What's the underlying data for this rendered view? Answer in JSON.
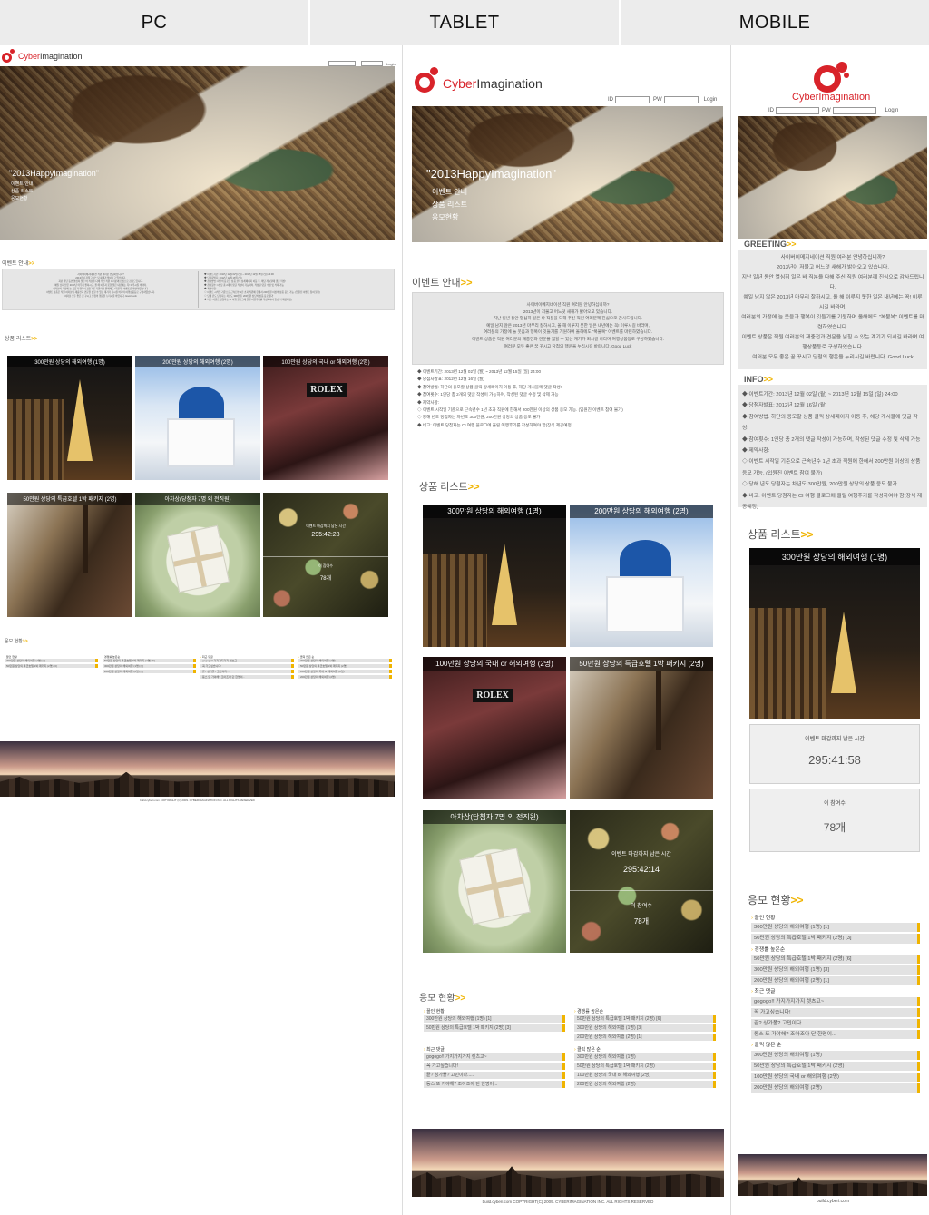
{
  "columns": {
    "pc": "PC",
    "tablet": "TABLET",
    "mobile": "MOBILE"
  },
  "logo": {
    "prefix": "Cyber",
    "suffix": "Imagination"
  },
  "login": {
    "id_label": "ID",
    "pw_label": "PW",
    "button": "Login"
  },
  "hero": {
    "title": "\"2013HappyImagination\"",
    "menu": [
      "이벤트 안내",
      "상품 리스트",
      "응모현황"
    ]
  },
  "sections": {
    "event": "이벤트 안내",
    "greeting": "GREETING",
    "info": "INFO",
    "products": "상품 리스트",
    "status": "응모 현황"
  },
  "greeting_text": [
    "사이버이메지네이션 직원 여러분 안녕하십니까?",
    "2013년이 저물고 어느덧 새해가 밝아오고 있습니다.",
    "지난 일년 동안 열심히 일은 바 직분을 다해 주신 직원 여러분께 진심으로 감사드립니다.",
    "예일 남지 않은 2013년 마무리 잘하시고, 올 해 이루지 못한 일은 내년에는 꼭! 이루시길 바라며,",
    "여러분의 가정에 늘 웃음과 행복이 깃들기를 기원하며 올해에도 \"복불복\" 이벤트를 마련하였습니다.",
    "이벤트 상품은 직원 여러분의 재충전과 견문을 넓힐 수 있는 계기가 되시길 바라며 여행상품등로 구성하였습니다.",
    "여러분 모두 좋은 꿈 꾸시고 당첨의 행운을 누리시길 바랍니다. Good Luck"
  ],
  "info_items": [
    "◆ 이벤트기간: 2013년 12월 02일 (월) ~ 2013년 12월 15일 (일) 24:00",
    "◆ 당첨자발표: 2012년 12월 16일 (월)",
    "◆ 참여방법: 하단의 응모할 상품 클릭 상세페이지 이동 후, 해당 게시물에 댓글 작성!",
    "◆ 참여횟수: 1인당 총 2개의 댓글 작성이 가능하며, 작성된 댓글 수정 및 삭제 가능",
    "◆ 제약사항:",
    "◇ 이벤트 시작일 기준으로 근속년수 1년 초과 직원에 한해서 200만원 이상의 상품 응모 가능. (입원진 이벤트 참여 불가)",
    "◇ 당해 년도 당첨자는 차년도 300만원, 200만원 상당의 상품 응모 불가",
    "◆ 비고: 이벤트 당첨자는 CI 여행 블로그에 올릴 여행후기를 작성하여야 함(장식 제공예정)"
  ],
  "products": [
    {
      "label": "300만원 상당의 해외여행 (1명)"
    },
    {
      "label": "200만원 상당의 해외여행 (2명)"
    },
    {
      "label": "100만원 상당의 국내 or 해외여행 (2명)"
    },
    {
      "label": "50만원 상당의 특급호텔 1박 패키지 (2명)"
    },
    {
      "label": "아차상(당첨자 7명 외 전직원)"
    }
  ],
  "countdown": {
    "label": "이벤트 마감까지 남은 시간",
    "pc_time": "295:42:28",
    "tablet_time": "295:42:14",
    "mobile_time": "295:41:58",
    "participants_label": "이 참여수",
    "participants": "78개"
  },
  "status_groups": [
    {
      "title": "꼴인 현황",
      "items": [
        "300만원 상당의 해외여행 (1명) [1]",
        "50만원 상당의 특급호텔 1박 패키지 (2명) [3]"
      ]
    },
    {
      "title": "경쟁률 높은순",
      "items": [
        "50만원 상당의 특급호텔 1박 패키지 (2명) [6]",
        "300만원 상당의 해외여행 (1명) [3]",
        "200만원 상당의 해외여행 (2명) [1]"
      ]
    },
    {
      "title": "최근 댓글",
      "items": [
        "gogogo!! 가지가지가지 렛츠고~",
        "꼭 가고싶습니다!",
        "끝? 싱가폴? 고민이다.....",
        "동스 또 가야해? 조아조아 단 한명이..."
      ]
    },
    {
      "title": "클릭 많은 순",
      "items": [
        "300만원 상당의 해외여행 (1명)",
        "50만원 상당의 특급호텔 1박 패키지 (2명)",
        "100만원 상당의 국내 or 해외여행 (2명)",
        "200만원 상당의 해외여행 (2명)"
      ]
    }
  ],
  "footer": {
    "pc": "build.cyberi.com COPYRIGHT (C) 2009. CYBERIMAGINATION INC. ALL RIGHTS RESERVED",
    "tablet": "build.cyberi.com COPYRIGHT(C) 2009. CYBERIMAGINATION INC. ALL RIGHTS RESERVED",
    "mobile": "build.cyberi.com"
  },
  "colors": {
    "accent": "#f0b400",
    "brand_red": "#d8232a",
    "header_bg": "#ececec"
  }
}
